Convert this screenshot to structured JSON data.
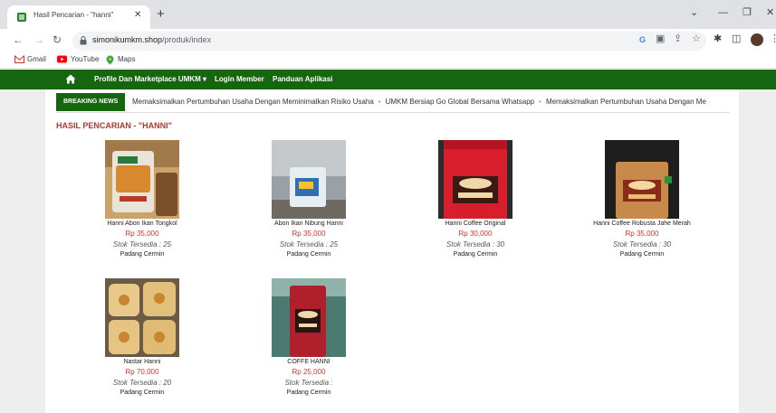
{
  "browser": {
    "tab_title": "Hasil Pencarian - \"hanni\"",
    "url_host": "simonikumkm.shop",
    "url_path": "/produk/index",
    "bookmarks": [
      {
        "label": "Gmail",
        "icon": "gmail-icon"
      },
      {
        "label": "YouTube",
        "icon": "youtube-icon"
      },
      {
        "label": "Maps",
        "icon": "maps-icon"
      }
    ]
  },
  "site": {
    "nav": {
      "profile": "Profile Dan Marketplace UMKM",
      "login": "Login Member",
      "guide": "Panduan Aplikasi"
    },
    "ticker": {
      "label": "BREAKING NEWS",
      "items": [
        "Memaksimalkan Pertumbuhan Usaha Dengan Meminimalkan Risiko Usaha",
        "UMKM Bersiap Go Global Bersama Whatsapp",
        "Memaksimalkan Pertumbuhan Usaha Dengan Me"
      ]
    },
    "results_title": "HASIL PENCARIAN - \"HANNI\""
  },
  "products": [
    {
      "name": "Hanni Abon Ikan Tongkol",
      "price": "Rp 35,000",
      "stock": "Stok Tersedia : 25",
      "location": "Padang Cermin"
    },
    {
      "name": "Abon Ikan Nibung Hanni",
      "price": "Rp 35,000",
      "stock": "Stok Tersedia : 25",
      "location": "Padang Cermin"
    },
    {
      "name": "Hanni Coffee Original",
      "price": "Rp 30,000",
      "stock": "Stok Tersedia : 30",
      "location": "Padang Cermin"
    },
    {
      "name": "Hanni Coffee Robusta Jahe Merah",
      "price": "Rp 35,000",
      "stock": "Stok Tersedia : 30",
      "location": "Padang Cermin"
    },
    {
      "name": "Nastar Hanni",
      "price": "Rp 70,000",
      "stock": "Stok Tersedia : 20",
      "location": "Padang Cermin"
    },
    {
      "name": "COFFE HANNI",
      "price": "Rp 25,000",
      "stock": "Stok Tersedia :",
      "location": "Padang Cermin"
    }
  ],
  "colors": {
    "nav_green": "#16650f",
    "title_red": "#b03a2e",
    "price_red": "#e03030"
  }
}
